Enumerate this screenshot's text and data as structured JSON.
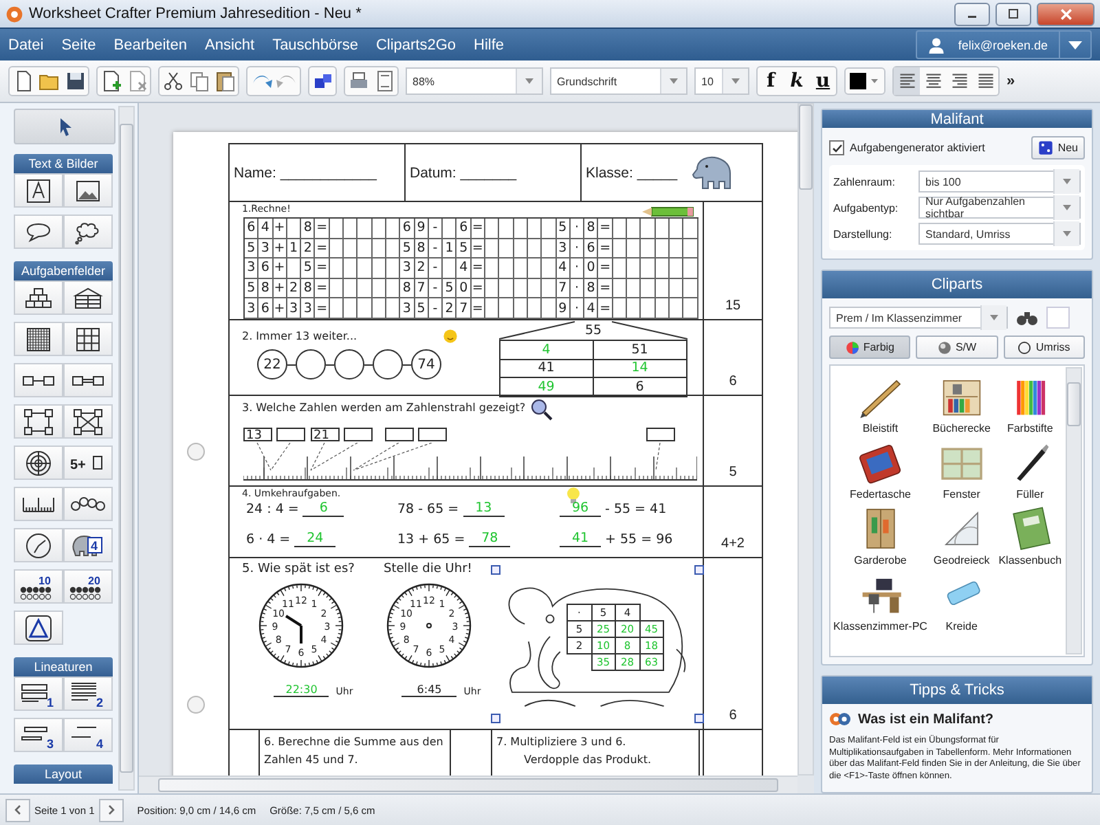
{
  "window": {
    "title": "Worksheet Crafter Premium Jahresedition - Neu *"
  },
  "menu": [
    "Datei",
    "Seite",
    "Bearbeiten",
    "Ansicht",
    "Tauschbörse",
    "Cliparts2Go",
    "Hilfe"
  ],
  "account": {
    "email": "felix@roeken.de"
  },
  "toolbar": {
    "zoom": "88%",
    "font": "Grundschrift",
    "size": "10",
    "format_buttons": [
      "f",
      "k",
      "u"
    ],
    "alignments": [
      {
        "selected": true
      },
      {
        "selected": false
      },
      {
        "selected": false
      },
      {
        "selected": false
      }
    ],
    "overflow": "»"
  },
  "sidebar": {
    "sections": [
      {
        "title": "Text & Bilder"
      },
      {
        "title": "Aufgabenfelder",
        "labels": [
          "5+",
          "4",
          "10",
          "20"
        ]
      },
      {
        "title": "Lineaturen",
        "labels": [
          "1",
          "2",
          "3",
          "4"
        ]
      },
      {
        "title": "Layout"
      }
    ]
  },
  "worksheet": {
    "header": [
      "Name: ____________",
      "Datum: _______",
      "Klasse: _____"
    ],
    "task1": {
      "title": "1.Rechne!",
      "points": "15",
      "rows": [
        [
          {
            "a": [
              "6",
              "4"
            ],
            "op": "+",
            "b": [
              "8"
            ],
            "eq": "="
          },
          {
            "a": [
              "6",
              "9"
            ],
            "op": "-",
            "b": [
              "6"
            ],
            "eq": "="
          },
          {
            "a": [
              "5"
            ],
            "op": "·",
            "b": [
              "8"
            ],
            "eq": "="
          }
        ],
        [
          {
            "a": [
              "5",
              "3"
            ],
            "op": "+",
            "b": [
              "1",
              "2"
            ],
            "eq": "="
          },
          {
            "a": [
              "5",
              "8"
            ],
            "op": "-",
            "b": [
              "1",
              "5"
            ],
            "eq": "="
          },
          {
            "a": [
              "3"
            ],
            "op": "·",
            "b": [
              "6"
            ],
            "eq": "="
          }
        ],
        [
          {
            "a": [
              "3",
              "6"
            ],
            "op": "+",
            "b": [
              "5"
            ],
            "eq": "="
          },
          {
            "a": [
              "3",
              "2"
            ],
            "op": "-",
            "b": [
              "4"
            ],
            "eq": "="
          },
          {
            "a": [
              "4"
            ],
            "op": "·",
            "b": [
              "0"
            ],
            "eq": "="
          }
        ],
        [
          {
            "a": [
              "5",
              "8"
            ],
            "op": "+",
            "b": [
              "2",
              "8"
            ],
            "eq": "="
          },
          {
            "a": [
              "8",
              "7"
            ],
            "op": "-",
            "b": [
              "5",
              "0"
            ],
            "eq": "="
          },
          {
            "a": [
              "7"
            ],
            "op": "·",
            "b": [
              "8"
            ],
            "eq": "="
          }
        ],
        [
          {
            "a": [
              "3",
              "6"
            ],
            "op": "+",
            "b": [
              "3",
              "3"
            ],
            "eq": "="
          },
          {
            "a": [
              "3",
              "5"
            ],
            "op": "-",
            "b": [
              "2",
              "7"
            ],
            "eq": "="
          },
          {
            "a": [
              "9"
            ],
            "op": "·",
            "b": [
              "4"
            ],
            "eq": "="
          }
        ]
      ]
    },
    "task2": {
      "title": "2. Immer 13 weiter...",
      "points": "6",
      "chain": {
        "first": "22",
        "last": "74"
      },
      "house": {
        "roof": "55",
        "rows": [
          [
            {
              "text": "4",
              "answer": true
            },
            {
              "text": "51",
              "answer": false
            }
          ],
          [
            {
              "text": "41",
              "answer": false
            },
            {
              "text": "14",
              "answer": true
            }
          ],
          [
            {
              "text": "49",
              "answer": true
            },
            {
              "text": "6",
              "answer": false
            }
          ]
        ]
      }
    },
    "task3": {
      "title": "3. Welche Zahlen werden am Zahlenstrahl gezeigt?",
      "points": "5",
      "boxes": [
        {
          "kind": "given",
          "value": "13"
        },
        {
          "kind": "blank"
        },
        {
          "kind": "given",
          "value": "21"
        },
        {
          "kind": "blank"
        },
        {
          "kind": "blank"
        },
        {
          "kind": "blank"
        },
        {
          "kind": "blank"
        }
      ]
    },
    "task4": {
      "title": "4. Umkehraufgaben.",
      "points": "4+2",
      "rows": [
        [
          {
            "before": "24 : 4 =",
            "answer": "6"
          },
          {
            "before": "78 - 65 =",
            "answer": "13"
          },
          {
            "answer": "96",
            "after": "- 55 = 41"
          }
        ],
        [
          {
            "before": "6 · 4 =",
            "answer": "24"
          },
          {
            "before": "13 + 65 =",
            "answer": "78"
          },
          {
            "answer": "41",
            "after": "+ 55 = 96"
          }
        ]
      ]
    },
    "task5": {
      "title": "5. Wie spät ist es?",
      "title_2": "Stelle die Uhr!",
      "points": "6",
      "clocks": [
        {
          "dial": [
            "11",
            "12",
            "1",
            "10",
            "2",
            "9",
            "3",
            "8",
            "4",
            "7",
            "6",
            "5"
          ],
          "time": "22:30",
          "answer": true,
          "hands": true,
          "unit": "Uhr"
        },
        {
          "dial": [
            "11",
            "12",
            "1",
            "10",
            "2",
            "9",
            "3",
            "8",
            "4",
            "7",
            "6",
            "5"
          ],
          "time": "6:45",
          "answer": false,
          "hands": false,
          "unit": "Uhr"
        }
      ],
      "malifant": {
        "selected": true,
        "rows": [
          [
            {
              "text": "·",
              "answer": false
            },
            {
              "text": "5",
              "answer": false
            },
            {
              "text": "4",
              "answer": false
            }
          ],
          [
            {
              "text": "5",
              "answer": false
            },
            {
              "text": "25",
              "answer": true
            },
            {
              "text": "20",
              "answer": true
            },
            {
              "text": "45",
              "answer": true
            }
          ],
          [
            {
              "text": "2",
              "answer": false
            },
            {
              "text": "10",
              "answer": true
            },
            {
              "text": "8",
              "answer": true
            },
            {
              "text": "18",
              "answer": true
            }
          ],
          [
            "",
            {
              "text": "35",
              "answer": true
            },
            {
              "text": "28",
              "answer": true
            },
            {
              "text": "63",
              "answer": true
            }
          ]
        ]
      }
    },
    "task6": {
      "text": "6. Berechne die Summe aus den Zahlen 45 und 7."
    },
    "task7": {
      "line_1": "7. Multipliziere 3 und 6.",
      "line_2": "Verdopple das Produkt."
    }
  },
  "malifant_panel": {
    "title": "Malifant",
    "generator": {
      "label": "Aufgabengenerator aktiviert",
      "checked": true
    },
    "new_button": "Neu",
    "fields": [
      {
        "label": "Zahlenraum:",
        "value": "bis 100"
      },
      {
        "label": "Aufgabentyp:",
        "value": "Nur Aufgabenzahlen sichtbar"
      },
      {
        "label": "Darstellung:",
        "value": "Standard, Umriss"
      }
    ]
  },
  "cliparts": {
    "title": "Cliparts",
    "category": "Prem / Im Klassenzimmer",
    "filters": [
      {
        "label": "Farbig",
        "selected": true
      },
      {
        "label": "S/W",
        "selected": false
      },
      {
        "label": "Umriss",
        "selected": false
      }
    ],
    "items": [
      "Bleistift",
      "Bücherecke",
      "Farbstifte",
      "Federtasche",
      "Fenster",
      "Füller",
      "Garderobe",
      "Geodreieck",
      "Klassenbuch",
      "Klassenzimmer-PC",
      "Kreide"
    ]
  },
  "tips": {
    "title": "Tipps & Tricks",
    "heading": "Was ist ein Malifant?",
    "text": "Das Malifant-Feld ist ein Übungsformat für Multiplikationsaufgaben in Tabellenform. Mehr Informationen über das Malifant-Feld finden Sie in der Anleitung, die Sie über die <F1>-Taste öffnen können."
  },
  "status_bar": {
    "page": "Seite 1 von 1",
    "position": "Position: 9,0 cm / 14,6 cm",
    "size": "Größe: 7,5 cm / 5,6 cm"
  }
}
